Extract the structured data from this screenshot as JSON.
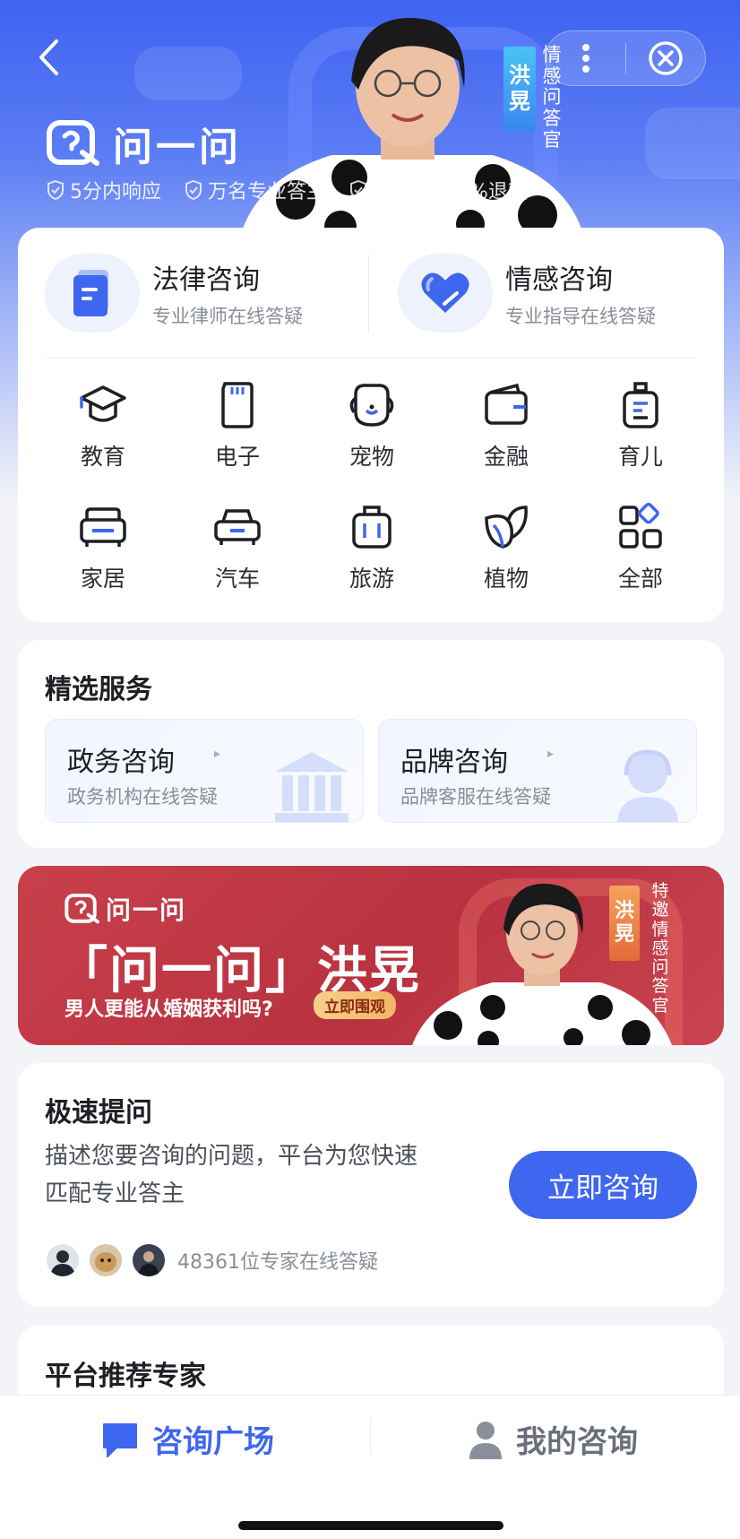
{
  "header": {
    "app_name": "问一问",
    "badges": [
      "5分内响应",
      "万名专业答主",
      "不满意100%退款"
    ],
    "expert_name_chars": [
      "洪",
      "晃"
    ],
    "expert_title_chars": [
      "情",
      "感",
      "问",
      "答",
      "官"
    ],
    "accent": "#3f63f2"
  },
  "categories": {
    "primary": [
      {
        "title": "法律咨询",
        "subtitle": "专业律师在线答疑",
        "icon": "document-icon"
      },
      {
        "title": "情感咨询",
        "subtitle": "专业指导在线答疑",
        "icon": "heart-icon"
      }
    ],
    "items": [
      {
        "label": "教育",
        "icon": "graduation-cap-icon"
      },
      {
        "label": "电子",
        "icon": "sd-card-icon"
      },
      {
        "label": "宠物",
        "icon": "pet-icon"
      },
      {
        "label": "金融",
        "icon": "wallet-icon"
      },
      {
        "label": "育儿",
        "icon": "baby-bottle-icon"
      },
      {
        "label": "家居",
        "icon": "sofa-icon"
      },
      {
        "label": "汽车",
        "icon": "car-icon"
      },
      {
        "label": "旅游",
        "icon": "suitcase-icon"
      },
      {
        "label": "植物",
        "icon": "leaf-icon"
      },
      {
        "label": "全部",
        "icon": "grid-icon"
      }
    ]
  },
  "featured": {
    "title": "精选服务",
    "services": [
      {
        "title": "政务咨询",
        "subtitle": "政务机构在线答疑",
        "icon": "government-building-icon"
      },
      {
        "title": "品牌咨询",
        "subtitle": "品牌客服在线答疑",
        "icon": "customer-service-icon"
      }
    ]
  },
  "banner": {
    "logo_text": "问一问",
    "headline": "「问一问」洪晃",
    "subline": "男人更能从婚姻获利吗?",
    "cta": "立即围观",
    "name_chars": [
      "洪",
      "晃"
    ],
    "title_chars": [
      "特",
      "邀",
      "情",
      "感",
      "问",
      "答",
      "官"
    ]
  },
  "quick_ask": {
    "title": "极速提问",
    "description": "描述您要咨询的问题，平台为您快速匹配专业答主",
    "button": "立即咨询",
    "expert_count_text": "48361位专家在线答疑"
  },
  "recommend": {
    "title": "平台推荐专家"
  },
  "tabbar": {
    "tabs": [
      {
        "label": "咨询广场",
        "icon": "chat-bubble-icon",
        "active": true,
        "color": "#3f66ef"
      },
      {
        "label": "我的咨询",
        "icon": "user-icon",
        "active": false,
        "color": "#6b6f79"
      }
    ]
  }
}
